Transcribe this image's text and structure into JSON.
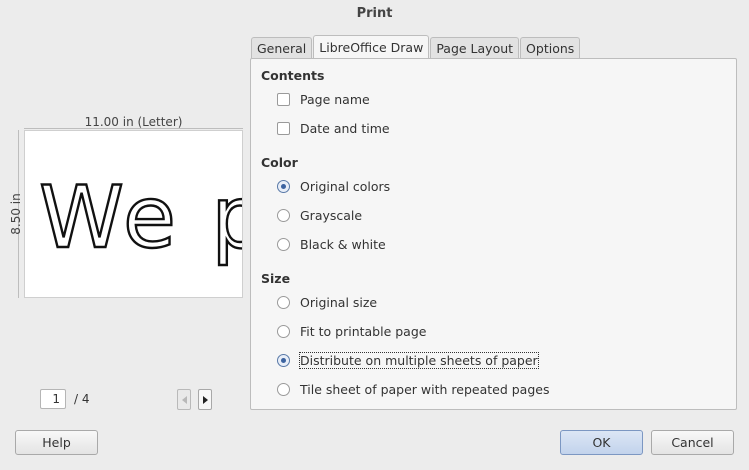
{
  "window": {
    "title": "Print"
  },
  "preview": {
    "width_label": "11.00 in (Letter)",
    "height_label": "8.50 in",
    "current_page": "1",
    "total_pages": "/ 4",
    "preview_text": "We po"
  },
  "tabs": [
    {
      "label": "General",
      "active": false
    },
    {
      "label": "LibreOffice Draw",
      "active": true
    },
    {
      "label": "Page Layout",
      "active": false
    },
    {
      "label": "Options",
      "active": false
    }
  ],
  "contents": {
    "title": "Contents",
    "page_name": {
      "label": "Page name",
      "checked": false
    },
    "date_time": {
      "label": "Date and time",
      "checked": false
    }
  },
  "color": {
    "title": "Color",
    "options": [
      {
        "label": "Original colors",
        "selected": true
      },
      {
        "label": "Grayscale",
        "selected": false
      },
      {
        "label": "Black & white",
        "selected": false
      }
    ]
  },
  "size": {
    "title": "Size",
    "options": [
      {
        "label": "Original size",
        "selected": false
      },
      {
        "label": "Fit to printable page",
        "selected": false
      },
      {
        "label": "Distribute on multiple sheets of paper",
        "selected": true
      },
      {
        "label": "Tile sheet of paper with repeated pages",
        "selected": false
      }
    ]
  },
  "buttons": {
    "help": "Help",
    "ok": "OK",
    "cancel": "Cancel"
  },
  "colors": {
    "accent": "#3c63a0",
    "ok_button": "#c2d3ec"
  }
}
